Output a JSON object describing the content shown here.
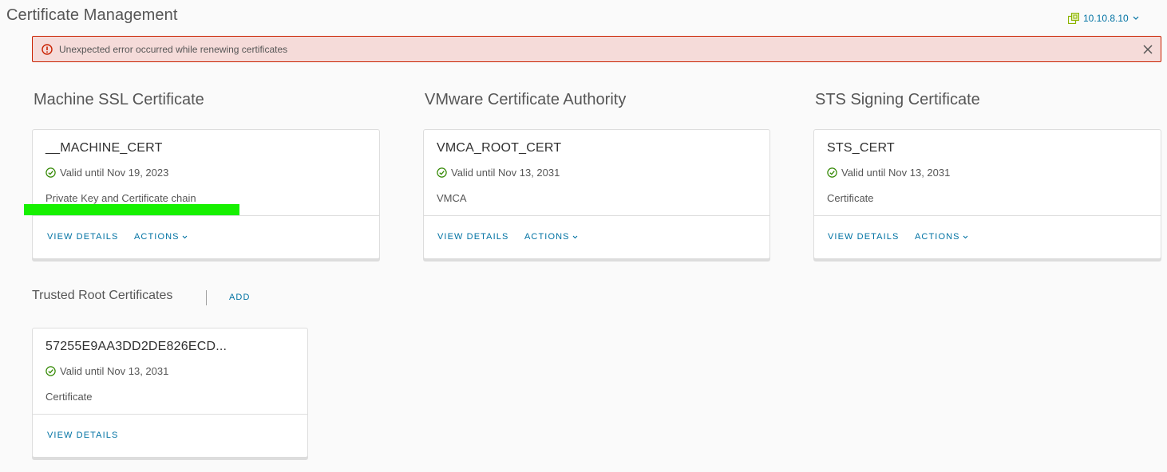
{
  "page": {
    "title": "Certificate Management"
  },
  "host": {
    "label": "10.10.8.10",
    "icon": "vcenter-host-icon"
  },
  "alert": {
    "message": "Unexpected error occurred while renewing certificates",
    "icon": "error-icon",
    "close_icon": "close-icon",
    "color": "#c92100",
    "background": "#f5dbd9"
  },
  "sections": {
    "machine_ssl": {
      "title": "Machine SSL Certificate",
      "card": {
        "name": "__MACHINE_CERT",
        "status": "Valid until Nov 19, 2023",
        "type": "Private Key and Certificate chain",
        "view_details": "VIEW DETAILS",
        "actions": "ACTIONS"
      }
    },
    "vmca": {
      "title": "VMware Certificate Authority",
      "card": {
        "name": "VMCA_ROOT_CERT",
        "status": "Valid until Nov 13, 2031",
        "type": "VMCA",
        "view_details": "VIEW DETAILS",
        "actions": "ACTIONS"
      }
    },
    "sts": {
      "title": "STS Signing Certificate",
      "card": {
        "name": "STS_CERT",
        "status": "Valid until Nov 13, 2031",
        "type": "Certificate",
        "view_details": "VIEW DETAILS",
        "actions": "ACTIONS"
      }
    },
    "trusted_root": {
      "title": "Trusted Root Certificates",
      "add_label": "ADD",
      "card": {
        "name": "57255E9AA3DD2DE826ECD...",
        "status": "Valid until Nov 13, 2031",
        "type": "Certificate",
        "view_details": "VIEW DETAILS"
      }
    }
  },
  "colors": {
    "link": "#0072a3",
    "success": "#318700",
    "redaction": "#16f000"
  }
}
